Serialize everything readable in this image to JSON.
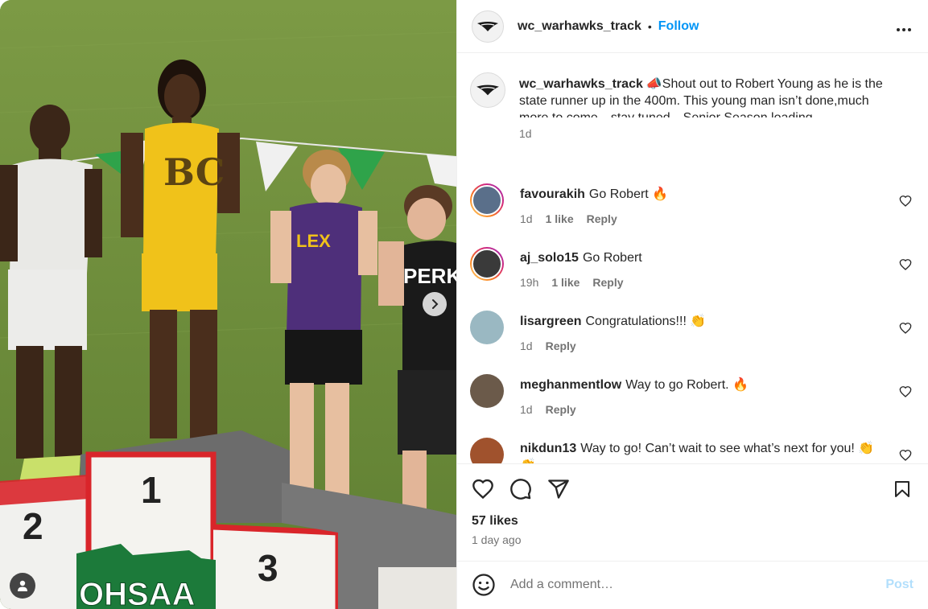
{
  "post": {
    "author": "wc_warhawks_track",
    "separator": "•",
    "follow_label": "Follow",
    "more_label": "•••",
    "caption_author": "wc_warhawks_track",
    "caption_text": "📣Shout out to Robert Young as he is the state runner up in the 400m. This young man isn’t done,much more to come…stay tuned…Senior Season loading…..",
    "caption_age": "1d"
  },
  "comments": [
    {
      "user": "favourakih",
      "text": "Go Robert 🔥",
      "age": "1d",
      "likes": "1 like",
      "reply": "Reply",
      "avatar_color": "#5a6f8a"
    },
    {
      "user": "aj_solo15",
      "text": "Go Robert",
      "age": "19h",
      "likes": "1 like",
      "reply": "Reply",
      "avatar_color": "#3a3a3a"
    },
    {
      "user": "lisargreen",
      "text": "Congratulations!!! 👏",
      "age": "1d",
      "likes": "",
      "reply": "Reply",
      "avatar_color": "#9ab8c2"
    },
    {
      "user": "meghanmentlow",
      "text": "Way to go Robert. 🔥",
      "age": "1d",
      "likes": "",
      "reply": "Reply",
      "avatar_color": "#6b5a4a"
    },
    {
      "user": "nikdun13",
      "text": "Way to go! Can’t wait to see what’s next for you! 👏👏",
      "age": "",
      "likes": "",
      "reply": "",
      "avatar_color": "#a0522d"
    }
  ],
  "engagement": {
    "likes": "57 likes",
    "time": "1 day ago"
  },
  "composer": {
    "placeholder": "Add a comment…",
    "post_label": "Post"
  },
  "photo": {
    "podium_numbers": [
      "1",
      "2",
      "3"
    ],
    "banner_text": "OHSAA",
    "jersey_lex": "LEX",
    "jersey_perk": "PERK"
  },
  "colors": {
    "accent": "#0095f6",
    "post_disabled": "#b2dffc",
    "grass": "#6f8f3a",
    "podium_red": "#d9252a"
  }
}
